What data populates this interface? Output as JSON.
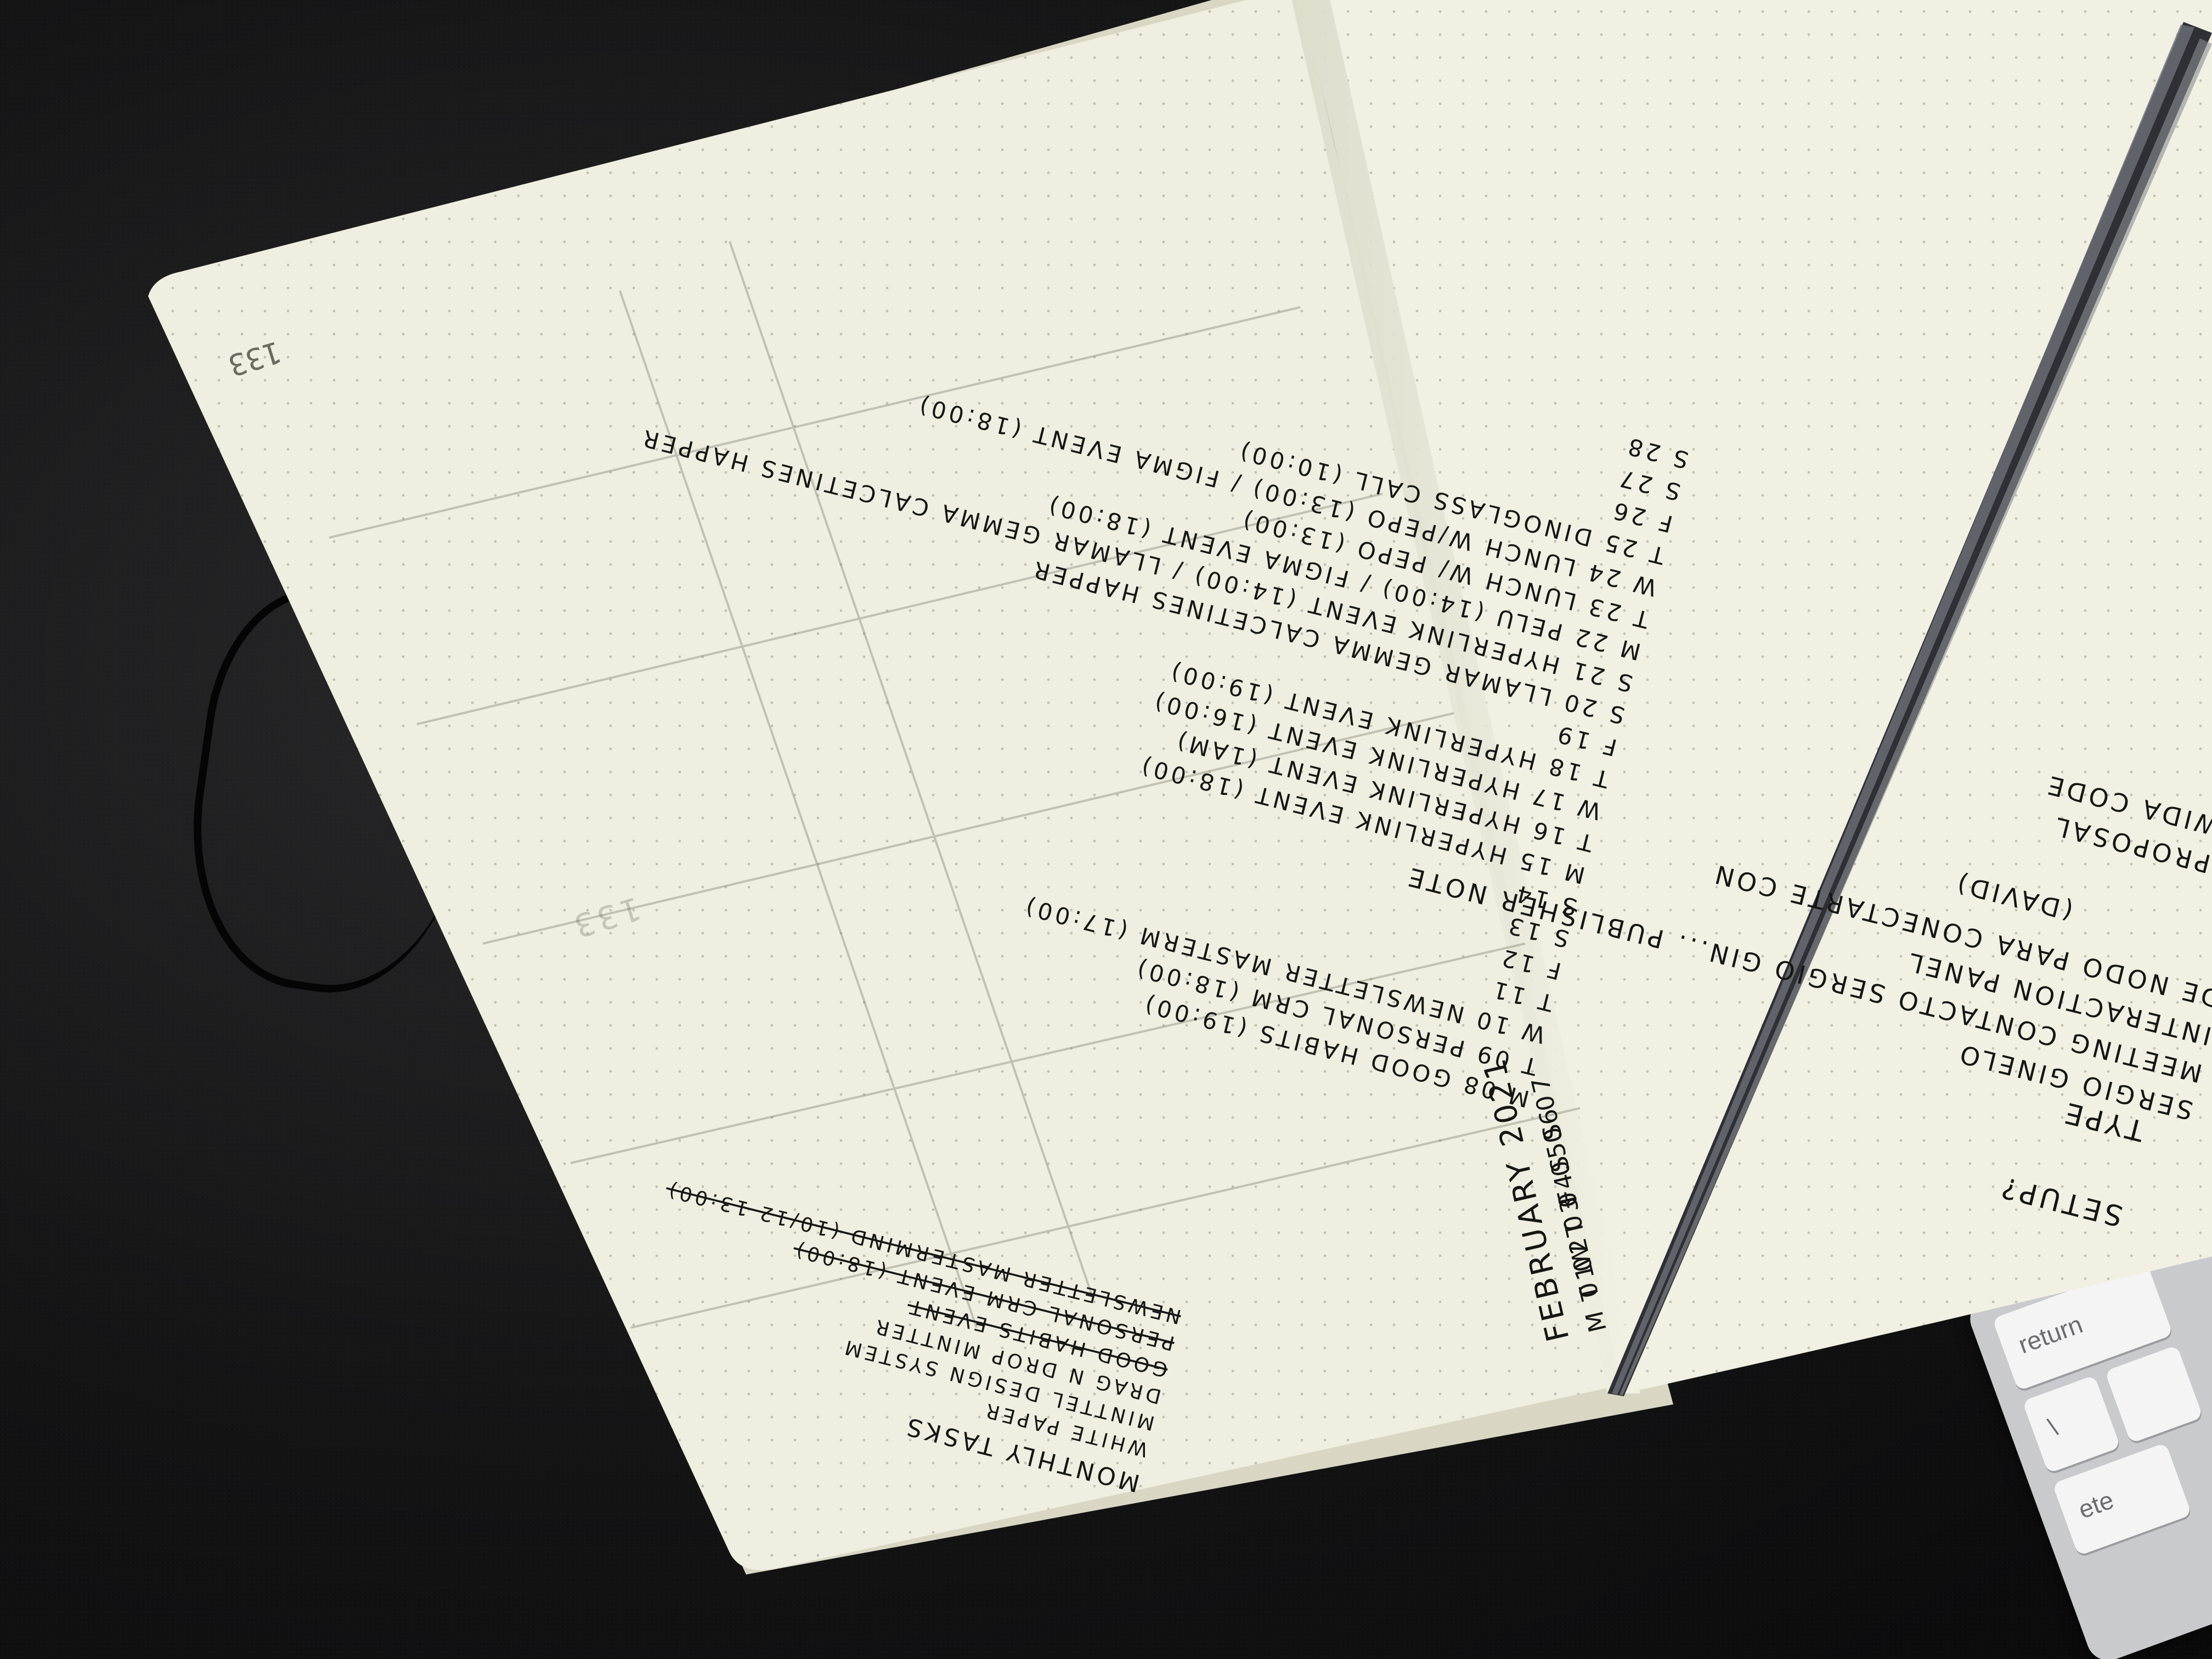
{
  "page_number": "133",
  "left_page": {
    "monthly_tasks_title": "MONTHLY TASKS",
    "month_header": "FEBRUARY 2021",
    "tasks": [
      {
        "text": "WHITE PAPER",
        "status": "migrated"
      },
      {
        "text": "MINTTEL DESIGN SYSTEM",
        "status": "migrated"
      },
      {
        "text": "DRAG N DROP MINTTER",
        "status": "migrated"
      },
      {
        "text": "GOOD HABITS EVENT",
        "status": "done"
      },
      {
        "text": "PERSONAL CRM EVENT (18:00)",
        "status": "done"
      },
      {
        "text": "NEWSLETTER MASTERMIND (10/12 13:00)",
        "status": "done"
      }
    ],
    "days": [
      "M 01",
      "T 02",
      "W 03",
      "T 04",
      "F 05",
      "S 06",
      "S 07",
      "M 08 GOOD HABITS (19:00)",
      "T 09 PERSONAL CRM (18:00)",
      "W 10 NEWSLETTER MASTERM (17:00)",
      "T 11",
      "F 12",
      "S 13",
      "S 14",
      "M 15 HYPERLINK EVENT (18:00)",
      "T 16 HYPERLINK EVENT (1AM)",
      "W 17 HYPERLINK EVENT (16:00)",
      "T 18 HYPERLINK EVENT (19:00)",
      "F 19",
      "S 20 LLAMAR GEMMA CALCETINES HAPPER",
      "S 21 HYPERLINK EVENT (14:00) / LLAMAR GEMMA CALCETINES HAPPER",
      "M 22 PELU (14:00) / FIGMA EVENT (18:00)",
      "T 23 LUNCH W/ PEPO (13:00)",
      "W 24 LUNCH W/PEPO (13:00) / FIGMA EVENT (18:00)",
      "T 25 DINOGLASS CALL (10:00)",
      "F 26",
      "S 27",
      "S 28"
    ]
  },
  "right_page": {
    "lines": [
      "SERGIO GINELO",
      "MEETING CONTACTO SERGIO GIN... PUBLISHER NOTE",
      "INTERACTION PANEL",
      "DE NODO PARA CONECTARTE CON",
      "(DAVID)",
      "PROPOSAL",
      "WIDA CODE",
      "TYPE",
      "SETUP?"
    ]
  },
  "keyboard": {
    "keys": [
      "return",
      "\\",
      "ete"
    ]
  },
  "colors": {
    "paper": "#efeee0",
    "ink": "#151515",
    "background": "#111112",
    "strap": "#3d3f44"
  }
}
